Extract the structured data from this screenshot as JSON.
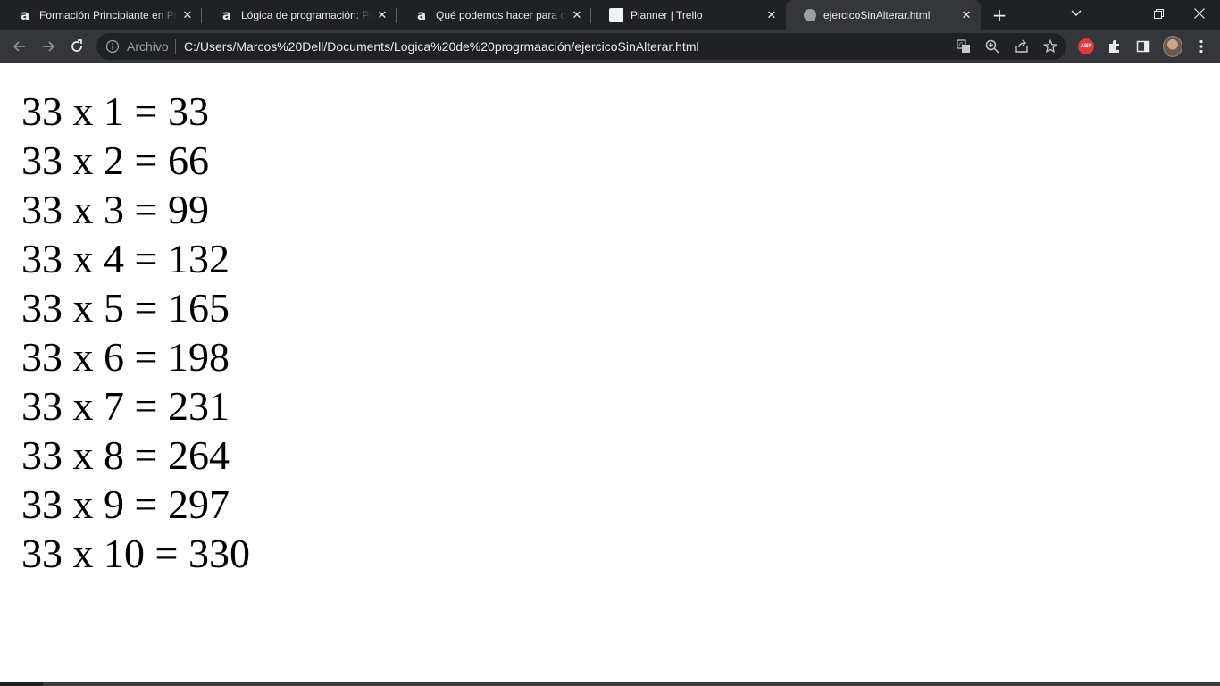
{
  "browser": {
    "tabs": [
      {
        "title": "Formación Principiante en Programación",
        "favicon": "alura-icon",
        "active": false
      },
      {
        "title": "Lógica de programación: Primeros pasos",
        "favicon": "alura-icon",
        "active": false
      },
      {
        "title": "Qué podemos hacer para calcular",
        "favicon": "alura-icon",
        "active": false
      },
      {
        "title": "Planner | Trello",
        "favicon": "trello-icon",
        "active": false
      },
      {
        "title": "ejercicoSinAlterar.html",
        "favicon": "globe-icon",
        "active": true
      }
    ],
    "address_bar": {
      "security_label": "Archivo",
      "url": "C:/Users/Marcos%20Dell/Documents/Logica%20de%20progrmaación/ejercicoSinAlterar.html"
    },
    "extensions": {
      "abp_label": "ABP"
    },
    "colors": {
      "tabstrip": "#202124",
      "toolbar": "#35363a",
      "omnibox": "#202124",
      "abp": "#e5353e"
    }
  },
  "page": {
    "lines": [
      "33 x 1 = 33",
      "33 x 2 = 66",
      "33 x 3 = 99",
      "33 x 4 = 132",
      "33 x 5 = 165",
      "33 x 6 = 198",
      "33 x 7 = 231",
      "33 x 8 = 264",
      "33 x 9 = 297",
      "33 x 10 = 330"
    ]
  }
}
